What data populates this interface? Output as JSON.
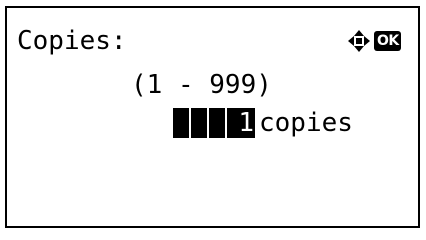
{
  "screen": {
    "title": "Copies:",
    "range": "(1 - 999)",
    "value": "1",
    "unit": "copies",
    "ok_label": "OK"
  },
  "icons": {
    "navigation": "four-way-arrow-icon",
    "confirm": "ok-icon"
  }
}
